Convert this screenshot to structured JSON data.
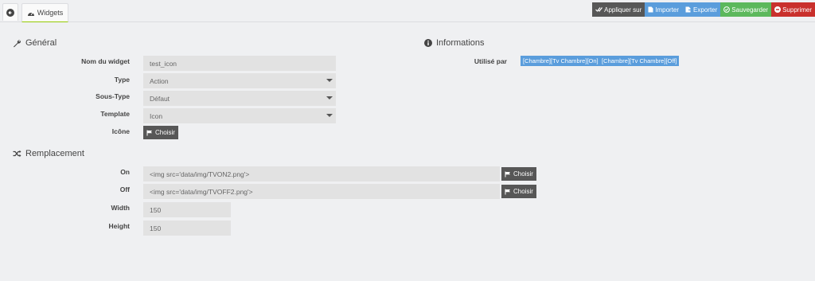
{
  "tabs": {
    "widgets_label": "Widgets"
  },
  "toolbar": {
    "apply_label": "Appliquer sur",
    "import_label": "Importer",
    "export_label": "Exporter",
    "save_label": "Sauvegarder",
    "delete_label": "Supprimer"
  },
  "general": {
    "title": "Général",
    "name_label": "Nom du widget",
    "name_value": "test_icon",
    "type_label": "Type",
    "type_value": "Action",
    "subtype_label": "Sous-Type",
    "subtype_value": "Défaut",
    "template_label": "Template",
    "template_value": "Icon",
    "icon_label": "Icône",
    "choose_label": "Choisir"
  },
  "info": {
    "title": "Informations",
    "used_by_label": "Utilisé par",
    "used_by": [
      "[Chambre][Tv Chambre][On]",
      "[Chambre][Tv Chambre][Off]"
    ]
  },
  "replacement": {
    "title": "Remplacement",
    "on_label": "On",
    "on_value": "<img src='data/img/TVON2.png'>",
    "off_label": "Off",
    "off_value": "<img src='data/img/TVOFF2.png'>",
    "width_label": "Width",
    "width_value": "150",
    "height_label": "Height",
    "height_value": "150",
    "choose_label": "Choisir"
  },
  "colors": {
    "apply": "#575757",
    "import": "#5a9ddc",
    "export": "#5a9ddc",
    "save": "#5cb85c",
    "delete": "#c9302c",
    "tab_accent": "#94ca02"
  }
}
